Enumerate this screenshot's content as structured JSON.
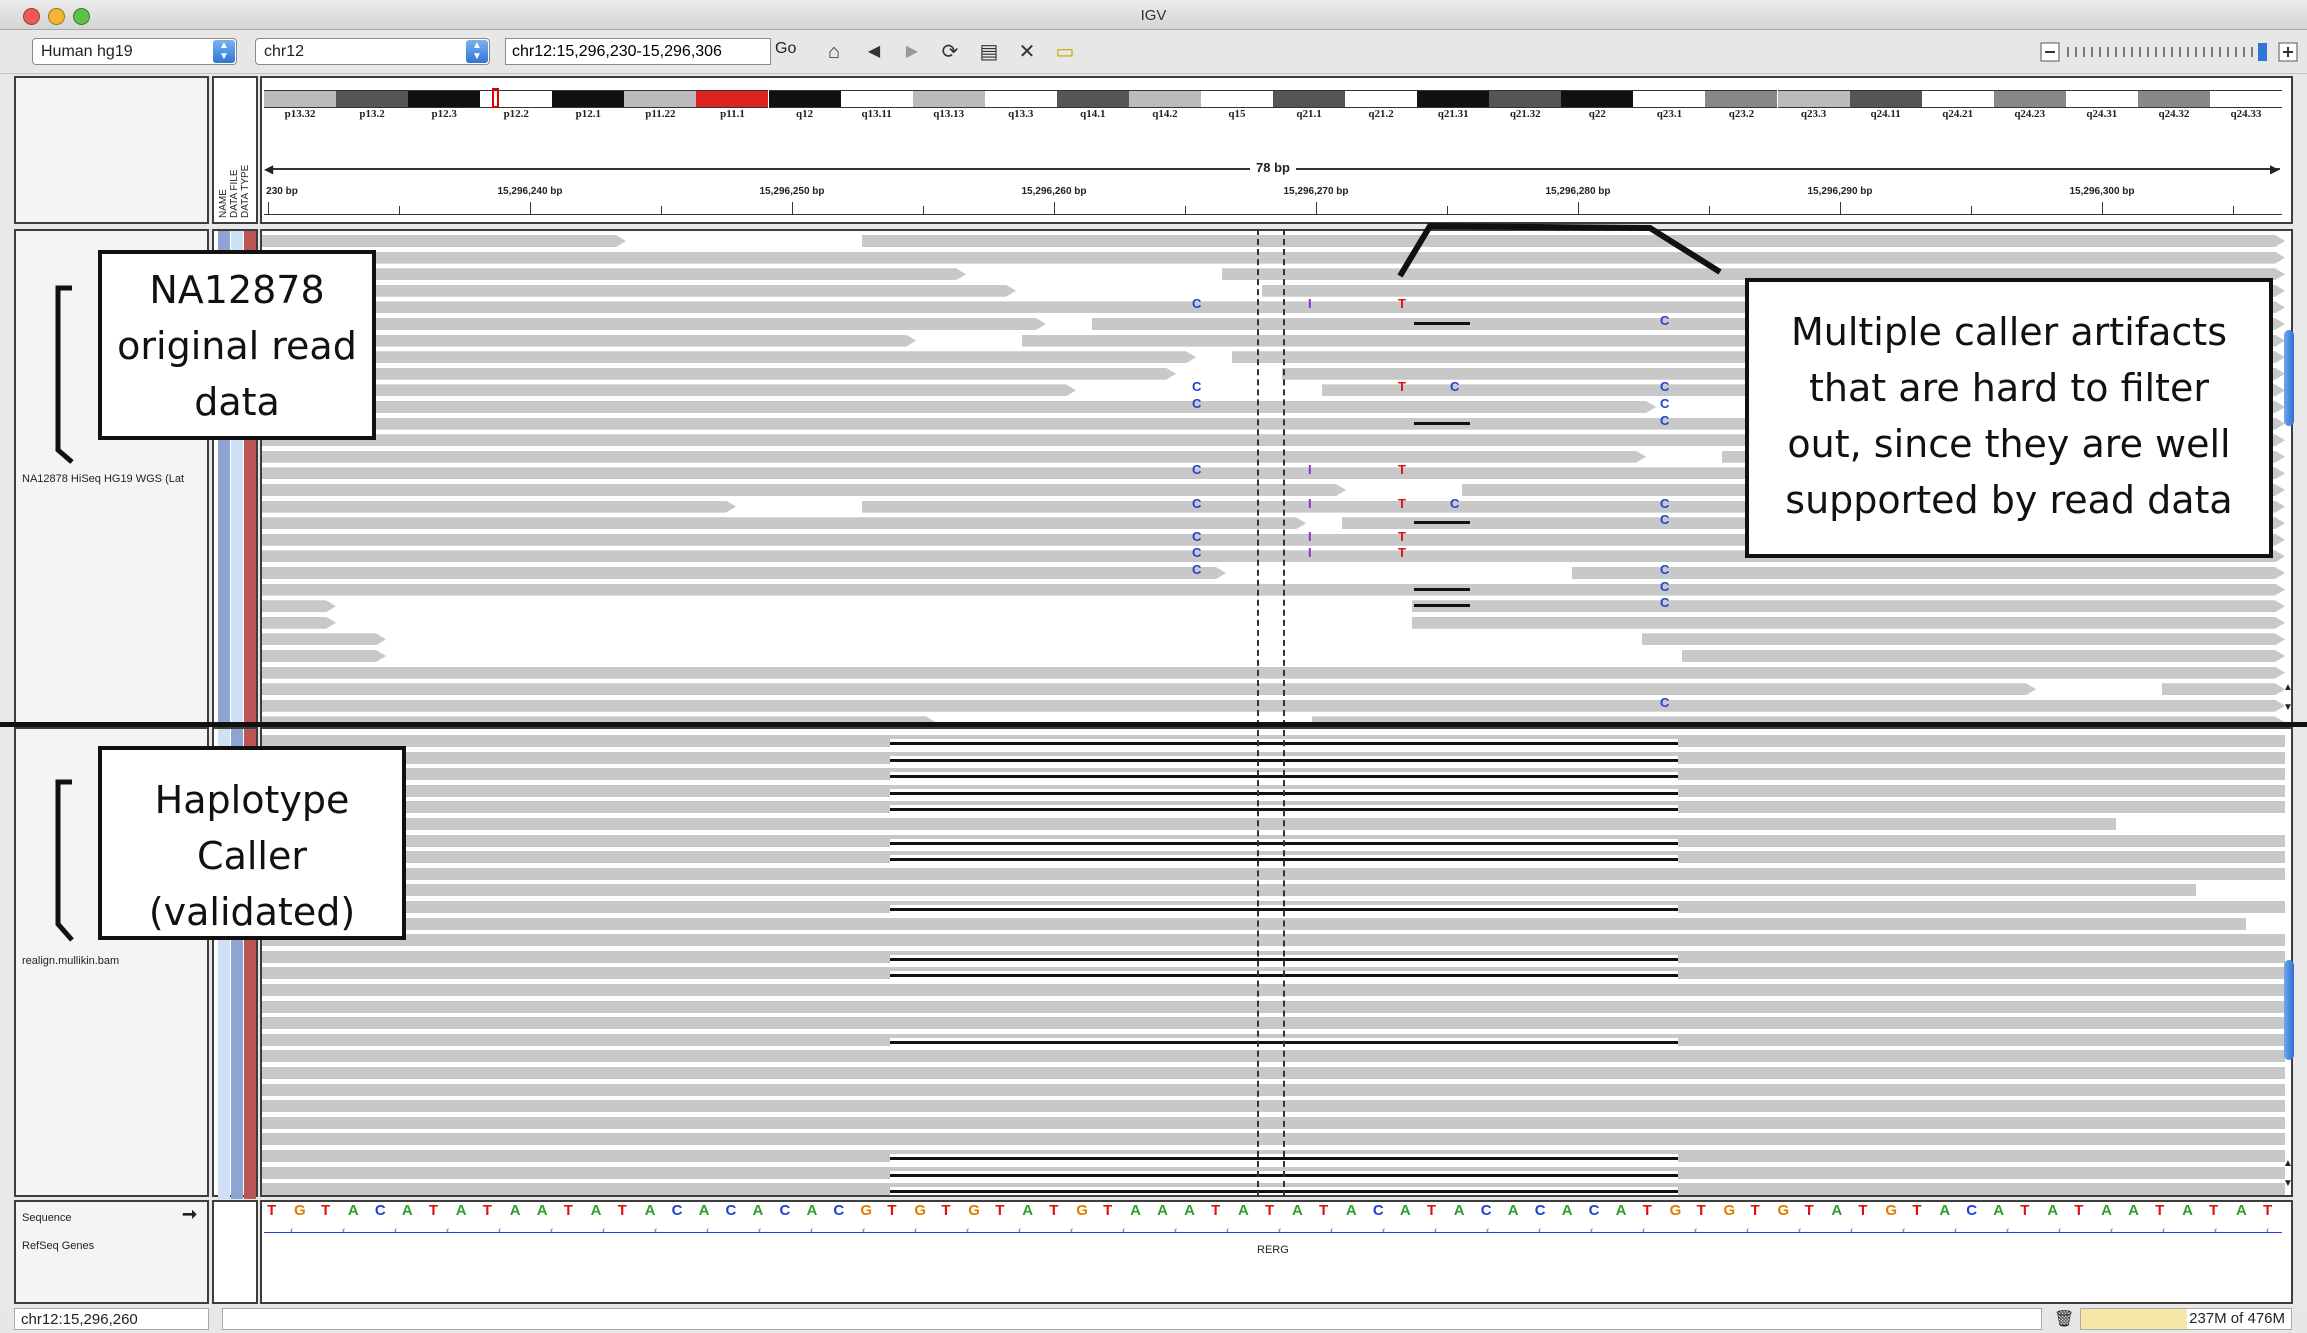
{
  "window": {
    "title": "IGV"
  },
  "toolbar": {
    "genome": "Human hg19",
    "chromosome": "chr12",
    "locus": "chr12:15,296,230-15,296,306",
    "go_label": "Go"
  },
  "ideogram": {
    "bands": [
      "p13.32",
      "p13.2",
      "p12.3",
      "p12.2",
      "p12.1",
      "p11.22",
      "p11.1",
      "q12",
      "q13.11",
      "q13.13",
      "q13.3",
      "q14.1",
      "q14.2",
      "q15",
      "q21.1",
      "q21.2",
      "q21.31",
      "q21.32",
      "q22",
      "q23.1",
      "q23.2",
      "q23.3",
      "q24.11",
      "q24.21",
      "q24.23",
      "q24.31",
      "q24.32",
      "q24.33"
    ]
  },
  "ruler": {
    "span_label": "78 bp",
    "ticks": [
      "230 bp",
      "15,296,240 bp",
      "15,296,250 bp",
      "15,296,260 bp",
      "15,296,270 bp",
      "15,296,280 bp",
      "15,296,290 bp",
      "15,296,300 bp"
    ]
  },
  "attribute_headers": [
    "NAME",
    "DATA FILE",
    "DATA TYPE"
  ],
  "tracks": {
    "track1_name": "NA12878 HiSeq HG19 WGS (Lat",
    "track2_name": "realign.mullikin.bam",
    "sequence_label": "Sequence",
    "refseq_label": "RefSeq Genes",
    "gene_name": "RERG"
  },
  "sequence": "TGTACATATAATATACACACACGTGTGTATGTAAATATATACATACACACATGTGTGTATGTACATATAATATAT",
  "annotations": {
    "na12878": "NA12878 original read data",
    "caller_artifacts": "Multiple caller artifacts that are hard to filter out, since they are well supported by read data",
    "haplotype": "Haplotype Caller (validated)"
  },
  "status": {
    "position": "chr12:15,296,260",
    "memory": "237M of 476M"
  },
  "colors": {
    "A": "#2ca02c",
    "C": "#1f3fd6",
    "G": "#e07b00",
    "T": "#e01010",
    "insertion": "#8a2be2",
    "read": "#c8c8c8"
  }
}
